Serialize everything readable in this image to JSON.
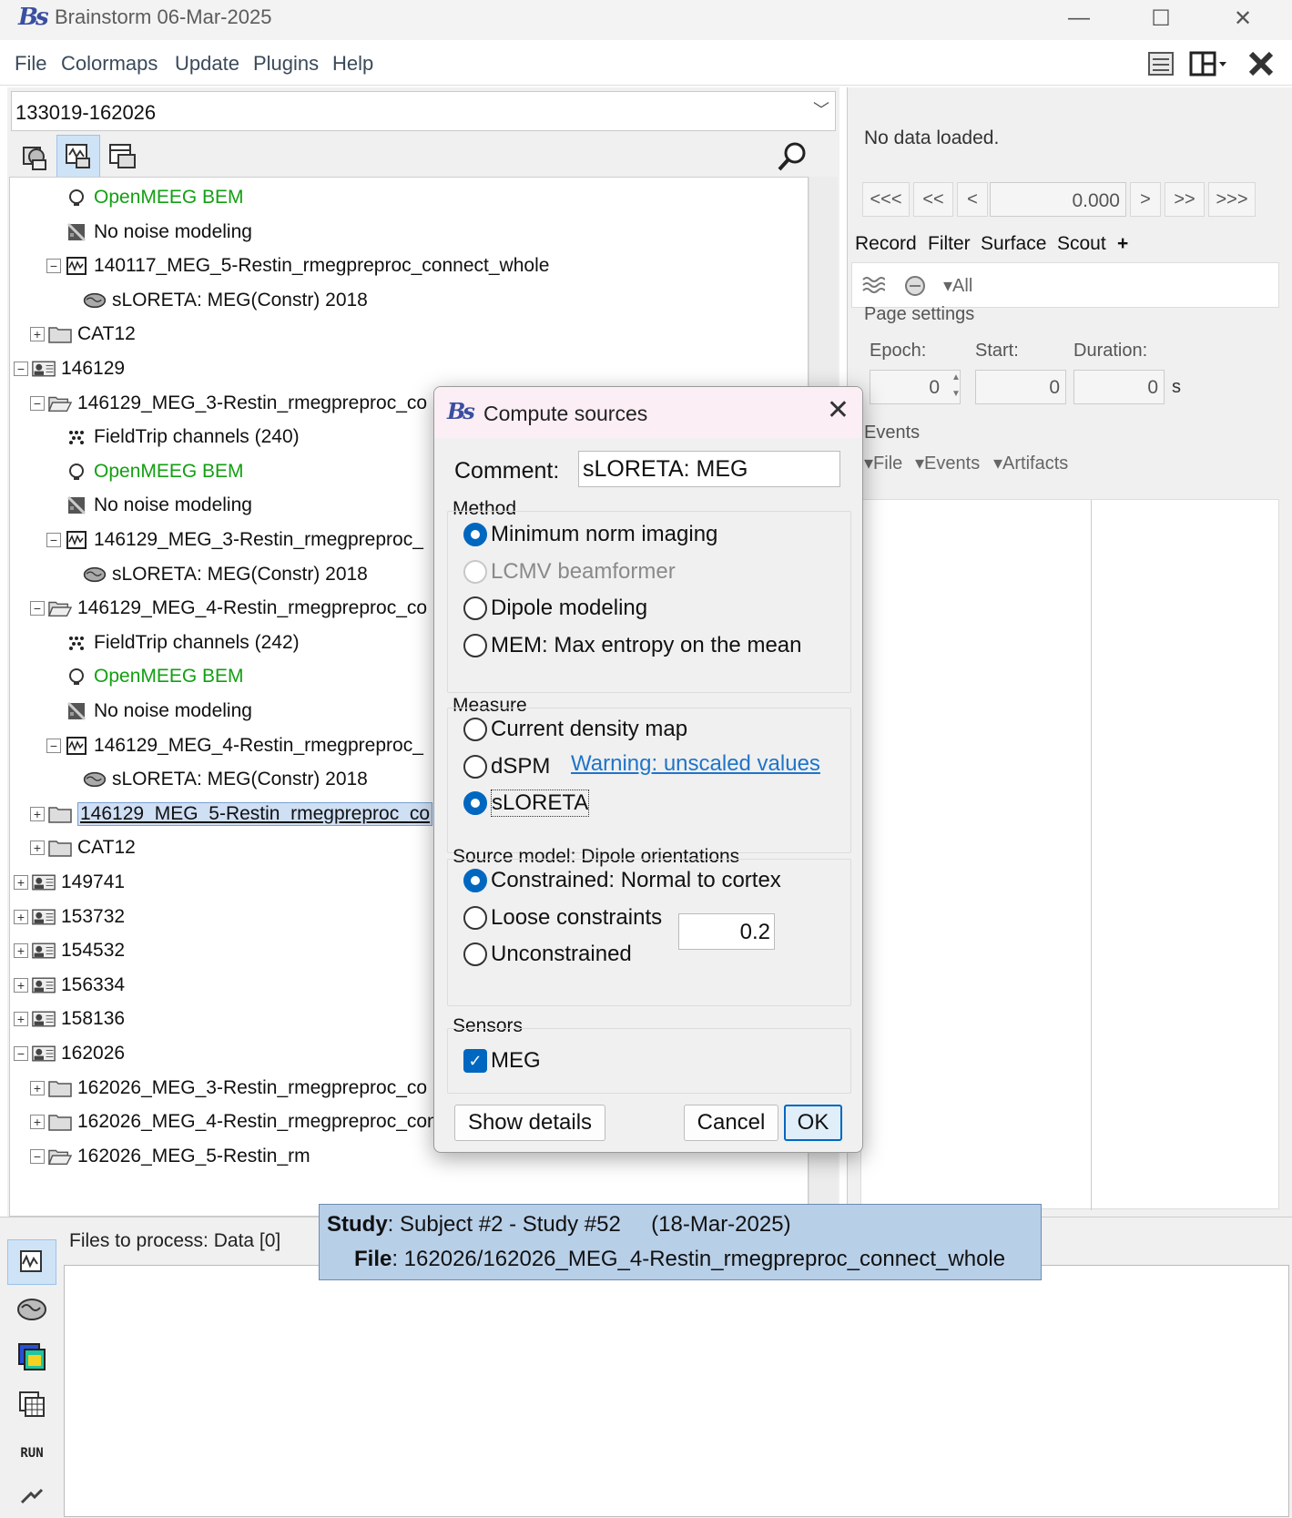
{
  "window": {
    "logo": "Bs",
    "title": "Brainstorm 06-Mar-2025",
    "minimize": "—",
    "maximize": "☐",
    "close": "✕"
  },
  "menu": [
    "File",
    "Colormaps",
    "Update",
    "Plugins",
    "Help"
  ],
  "toolbar_icons": [
    "list-view-icon",
    "layout-icon",
    "close-all-icon"
  ],
  "left_panel": {
    "protocol": "133019-162026",
    "view_tools": [
      "functional-view-icon",
      "anatomy-view-icon",
      "database-view-icon"
    ],
    "search_icon": "magnifier-icon",
    "tree": [
      {
        "label": "OpenMEEG BEM",
        "icon": "head-icon",
        "expander": "",
        "green": true
      },
      {
        "label": "No noise modeling",
        "icon": "noise-matrix-icon",
        "expander": ""
      },
      {
        "label": "140117_MEG_5-Restin_rmegpreproc_connect_whole",
        "icon": "data-icon",
        "expander": "−"
      },
      {
        "label": "sLORETA: MEG(Constr) 2018",
        "icon": "brain-icon",
        "expander": ""
      },
      {
        "label": "CAT12",
        "icon": "folder-icon",
        "expander": "+"
      },
      {
        "label": "146129",
        "icon": "subject-icon",
        "expander": "−"
      },
      {
        "label": "146129_MEG_3-Restin_rmegpreproc_co",
        "icon": "folder-open-icon",
        "expander": "−"
      },
      {
        "label": "FieldTrip channels (240)",
        "icon": "channel-icon",
        "expander": ""
      },
      {
        "label": "OpenMEEG BEM",
        "icon": "head-icon",
        "expander": "",
        "green": true
      },
      {
        "label": "No noise modeling",
        "icon": "noise-matrix-icon",
        "expander": ""
      },
      {
        "label": "146129_MEG_3-Restin_rmegpreproc_",
        "icon": "data-icon",
        "expander": "−"
      },
      {
        "label": "sLORETA: MEG(Constr) 2018",
        "icon": "brain-icon",
        "expander": ""
      },
      {
        "label": "146129_MEG_4-Restin_rmegpreproc_co",
        "icon": "folder-open-icon",
        "expander": "−"
      },
      {
        "label": "FieldTrip channels (242)",
        "icon": "channel-icon",
        "expander": ""
      },
      {
        "label": "OpenMEEG BEM",
        "icon": "head-icon",
        "expander": "",
        "green": true
      },
      {
        "label": "No noise modeling",
        "icon": "noise-matrix-icon",
        "expander": ""
      },
      {
        "label": "146129_MEG_4-Restin_rmegpreproc_",
        "icon": "data-icon",
        "expander": "−"
      },
      {
        "label": "sLORETA: MEG(Constr) 2018",
        "icon": "brain-icon",
        "expander": ""
      },
      {
        "label": "146129_MEG_5-Restin_rmegpreproc_co",
        "icon": "folder-icon",
        "expander": "+",
        "selected": true
      },
      {
        "label": "CAT12",
        "icon": "folder-icon",
        "expander": "+"
      },
      {
        "label": "149741",
        "icon": "subject-icon",
        "expander": "+"
      },
      {
        "label": "153732",
        "icon": "subject-icon",
        "expander": "+"
      },
      {
        "label": "154532",
        "icon": "subject-icon",
        "expander": "+"
      },
      {
        "label": "156334",
        "icon": "subject-icon",
        "expander": "+"
      },
      {
        "label": "158136",
        "icon": "subject-icon",
        "expander": "+"
      },
      {
        "label": "162026",
        "icon": "subject-icon",
        "expander": "−"
      },
      {
        "label": "162026_MEG_3-Restin_rmegpreproc_co",
        "icon": "folder-icon",
        "expander": "+"
      },
      {
        "label": "162026_MEG_4-Restin_rmegpreproc_connect_whole",
        "icon": "folder-icon",
        "expander": "+"
      },
      {
        "label": "162026_MEG_5-Restin_rm",
        "icon": "folder-open-icon",
        "expander": "−"
      }
    ]
  },
  "right_panel": {
    "status": "No data loaded.",
    "nav_buttons": [
      "<<<",
      "<<",
      "<",
      ">",
      ">>",
      ">>>"
    ],
    "time_value": "0.000",
    "tabs": [
      "Record",
      "Filter",
      "Surface",
      "Scout",
      "+"
    ],
    "strip_all": "▾All",
    "page_settings": {
      "title": "Page settings",
      "epoch_label": "Epoch:",
      "start_label": "Start:",
      "duration_label": "Duration:",
      "epoch_value": "0",
      "start_value": "0",
      "duration_value": "0",
      "unit": "s"
    },
    "events": {
      "title": "Events",
      "menus": [
        "File",
        "Events",
        "Artifacts"
      ]
    }
  },
  "bottom_panel": {
    "files_label": "Files to process: Data [0]",
    "side_tools": [
      "data-process-icon",
      "sources-process-icon",
      "timefreq-process-icon",
      "matrix-process-icon",
      "run-button",
      "pipeline-icon"
    ],
    "run_label": "RUN"
  },
  "tooltip": {
    "study_key": "Study",
    "study_value": ": Subject #2 - Study #52     (18-Mar-2025)",
    "file_key": "File",
    "file_value": ": 162026/162026_MEG_4-Restin_rmegpreproc_connect_whole"
  },
  "dialog": {
    "logo": "Bs",
    "title": "Compute sources",
    "close": "✕",
    "comment_label": "Comment:",
    "comment_value": "sLORETA: MEG",
    "method": {
      "title": "Method",
      "options": [
        {
          "label": "Minimum norm imaging",
          "checked": true,
          "disabled": false
        },
        {
          "label": "LCMV beamformer",
          "checked": false,
          "disabled": true
        },
        {
          "label": "Dipole modeling",
          "checked": false,
          "disabled": false
        },
        {
          "label": "MEM: Max entropy on the mean",
          "checked": false,
          "disabled": false
        }
      ]
    },
    "measure": {
      "title": "Measure",
      "options": [
        {
          "label": "Current density map",
          "checked": false
        },
        {
          "label": "dSPM",
          "checked": false
        },
        {
          "label": "sLORETA",
          "checked": true
        }
      ],
      "warning": "Warning: unscaled values"
    },
    "source_model": {
      "title": "Source model: Dipole orientations",
      "options": [
        {
          "label": "Constrained:  Normal to cortex",
          "checked": true
        },
        {
          "label": "Loose constraints",
          "checked": false
        },
        {
          "label": "Unconstrained",
          "checked": false
        }
      ],
      "loose_value": "0.2"
    },
    "sensors": {
      "title": "Sensors",
      "meg_label": "MEG",
      "meg_checked": true
    },
    "buttons": {
      "details": "Show details",
      "cancel": "Cancel",
      "ok": "OK"
    }
  },
  "colors": {
    "accent": "#0067c0",
    "green_label": "#12a012",
    "tooltip_bg": "#b8cfe8",
    "dialog_titlebar": "#fbeef4"
  }
}
